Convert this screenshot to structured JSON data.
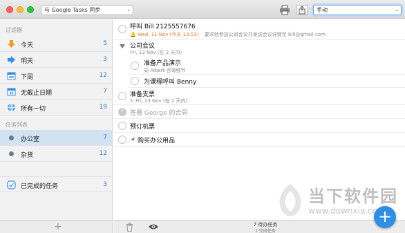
{
  "toolbar": {
    "sync_selector": "与 Google Tasks 同步",
    "sort_selector": "手动"
  },
  "sidebar": {
    "filters_header": "过滤器",
    "filters": [
      {
        "label": "今天",
        "count": "5",
        "icon": "arrow-down-icon"
      },
      {
        "label": "明天",
        "count": "3",
        "icon": "arrow-right-icon"
      },
      {
        "label": "下周",
        "count": "12",
        "icon": "calendar-week-icon"
      },
      {
        "label": "无截止日期",
        "count": "7",
        "icon": "calendar-x-icon"
      },
      {
        "label": "所有一切",
        "count": "19",
        "icon": "globe-icon"
      }
    ],
    "lists_header": "任务列表",
    "lists": [
      {
        "label": "办公室",
        "count": "7",
        "selected": true
      },
      {
        "label": "杂货",
        "count": "12",
        "selected": false
      }
    ],
    "completed": {
      "label": "已完成的任务",
      "count": "3",
      "icon": "checkbox-icon"
    }
  },
  "tasks": [
    {
      "title": "呼叫 Bill 2125557676",
      "date": "Wed, 11 Nov (今天 13:53)",
      "note": "要求他参加公司会议并发送会议详情至 bill@gmail.com"
    },
    {
      "title": "公司会议",
      "date": "Fri, 13 Nov (在 2 天内)"
    },
    {
      "title": "准备产品演示",
      "note": "向 Albert 咨询细节"
    },
    {
      "title": "为课程呼叫 Benny"
    },
    {
      "title": "准备支票",
      "date": "Fri, 13 Nov (在 2 天内)"
    },
    {
      "title": "签署 George 的合同",
      "done": true
    },
    {
      "title": "预订机票"
    },
    {
      "title": "购买办公用品"
    }
  ],
  "footer": {
    "pending": "7 待办任务",
    "completed": "1 完成任务"
  },
  "watermark": {
    "text": "当下软件园",
    "url": "www.downxia.com"
  },
  "colors": {
    "accent": "#2f8fe6",
    "count_blue": "#2c7fd0",
    "due_orange": "#ec7a2c",
    "selected_row": "#d3e2f0"
  }
}
